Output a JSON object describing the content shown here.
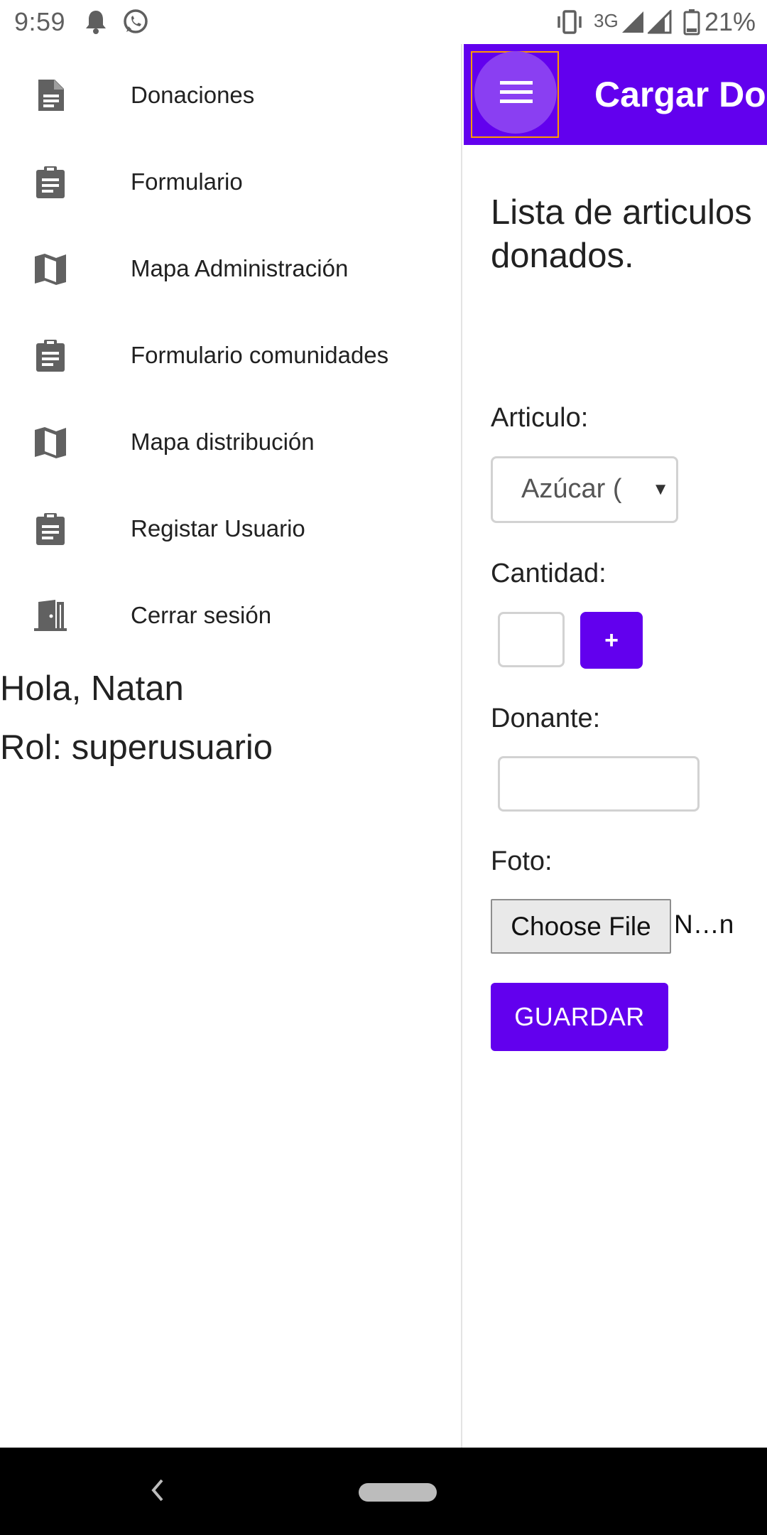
{
  "status_bar": {
    "time": "9:59",
    "network": "3G",
    "battery": "21%",
    "icons": [
      "notification-bell-icon",
      "whatsapp-icon",
      "vibrate-icon",
      "signal-icon",
      "signal-icon",
      "battery-icon"
    ]
  },
  "drawer": {
    "items": [
      {
        "label": "Donaciones",
        "icon": "document-icon"
      },
      {
        "label": "Formulario",
        "icon": "clipboard-icon"
      },
      {
        "label": "Mapa Administración",
        "icon": "map-icon"
      },
      {
        "label": "Formulario comunidades",
        "icon": "clipboard-icon"
      },
      {
        "label": "Mapa distribución",
        "icon": "map-icon"
      },
      {
        "label": "Registar Usuario",
        "icon": "clipboard-icon"
      },
      {
        "label": "Cerrar sesión",
        "icon": "door-exit-icon"
      }
    ],
    "greeting": "Hola, Natan",
    "role": "Rol: superusuario"
  },
  "appbar": {
    "title": "Cargar Donaciones",
    "menu_icon": "hamburger-menu-icon",
    "color": "#6200ee"
  },
  "form": {
    "heading": "Lista de articulos donados.",
    "articulo_label": "Articulo:",
    "articulo_value": "Azúcar (",
    "cantidad_label": "Cantidad:",
    "cantidad_value": "",
    "plus_label": "+",
    "donante_label": "Donante:",
    "donante_value": "",
    "foto_label": "Foto:",
    "file_button_label": "Choose File",
    "file_name": "N…n",
    "save_label": "GUARDAR"
  },
  "colors": {
    "accent": "#6200ee",
    "menu_button": "#8a3ff2",
    "focus_outline": "#ff9800"
  }
}
